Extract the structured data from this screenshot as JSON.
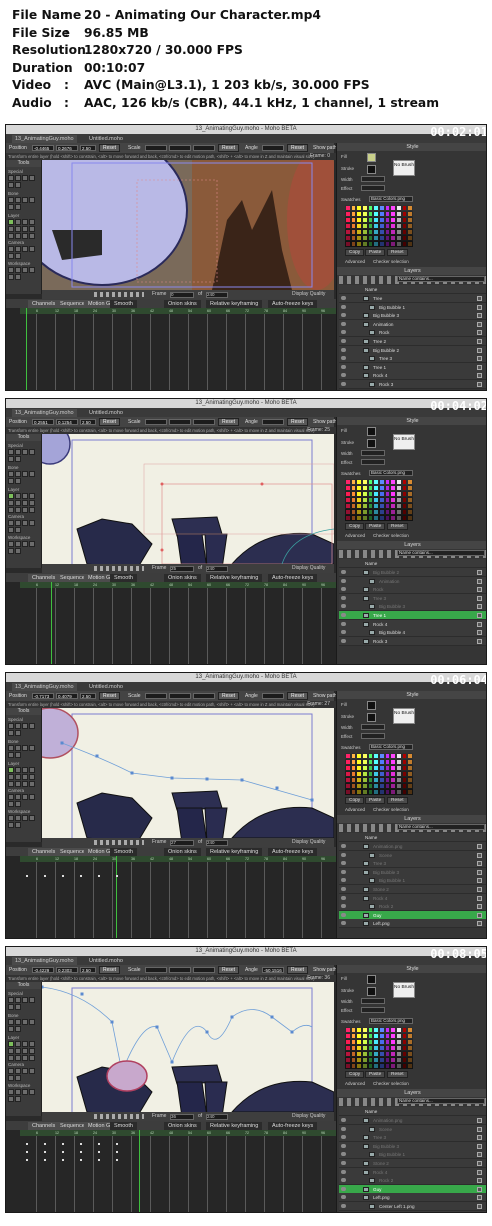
{
  "info": {
    "rows": [
      {
        "label": "File Name",
        "value": "20 - Animating Our Character.mp4"
      },
      {
        "label": "File Size",
        "value": "96.85 MB"
      },
      {
        "label": "Resolution",
        "value": "1280x720 / 30.000 FPS"
      },
      {
        "label": "Duration",
        "value": "00:10:07"
      },
      {
        "label": "Video",
        "value": "AVC (Main@L3.1), 1 203 kb/s, 30.000 FPS"
      },
      {
        "label": "Audio",
        "value": "AAC, 126 kb/s (CBR), 44.1 kHz, 1 channel, 1 stream"
      }
    ],
    "separator": ":"
  },
  "app": {
    "doc_tab_1": "13_AnimatingGuy.moho",
    "doc_tab_2": "Untitled.moho",
    "tools_title": "Tools",
    "tool_groups": [
      "Special",
      "Bone",
      "Layer",
      "Camera",
      "Workspace"
    ],
    "opt_position": "Position",
    "opt_scale": "Scale",
    "opt_angle": "Angle",
    "opt_reset": "Reset",
    "opt_showpath": "Show path",
    "hint": "Transform entire layer (hold <shift> to constrain, <alt> to move forward and back, <ctrl/cmd> to edit motion path, <shift> + <alt> to move in Z and maintain visual size)",
    "style_title": "Style",
    "fill_label": "Fill",
    "stroke_label": "Stroke",
    "width_label": "Width",
    "effect_label": "Effect",
    "no_brush": "No Brush",
    "swatches_label": "Swatches",
    "swatches_value": "Basic Colors.png",
    "copy": "Copy",
    "paste": "Paste",
    "reset": "Reset",
    "advanced": "Advanced",
    "checker": "Checker selection",
    "layers_title": "Layers",
    "name_col": "Name",
    "name_contains": "Name contains...",
    "tl_tabs": [
      "Channels",
      "Sequencer",
      "Motion Graph"
    ],
    "smooth": "Smooth",
    "onion": "Onion skins",
    "relative_kf": "Relative keyframing",
    "auto_freeze": "Auto-freeze keys",
    "display_quality": "Display Quality",
    "frame_label": "Frame",
    "of_label": "of",
    "total_frames": "240",
    "ruler_ticks": [
      "6",
      "12",
      "18",
      "24",
      "30",
      "36",
      "42",
      "48",
      "54",
      "60",
      "66",
      "72",
      "78",
      "84",
      "90",
      "96"
    ]
  },
  "frames": [
    {
      "timecode": "00:02:01",
      "title": "13_AnimatingGuy.moho - Moho BETA",
      "frame_no": "0",
      "status_frame": "Frame: 0",
      "pos_x": "-0.4465",
      "pos_y": "0.2676",
      "pos_z": "2.50",
      "layers": [
        "Tree",
        "Big Bubble 1",
        "Big Bubble 3",
        "Animation",
        "Rock",
        "Tree 2",
        "Big Bubble 2",
        "Tree 3",
        "Tree 1",
        "Rock 4",
        "Rock 3"
      ],
      "selected": -1
    },
    {
      "timecode": "00:04:02",
      "title": "13_AnimatingGuy.moho - Moho BETA",
      "frame_no": "25",
      "status_frame": "Frame: 25",
      "pos_x": "0.2551",
      "pos_y": "0.1254",
      "pos_z": "2.50",
      "layers": [
        "Big Bubble 2",
        "Animation",
        "Rock",
        "Tree 3",
        "Big Bubble 3",
        "Tree 1",
        "Rock 4",
        "Big Bubble 4",
        "Rock 3"
      ],
      "selected": 5
    },
    {
      "timecode": "00:06:04",
      "title": "13_AnimatingGuy.moho - Moho BETA",
      "frame_no": "27",
      "status_frame": "Frame: 27",
      "pos_x": "-0.7173",
      "pos_y": "0.4079",
      "pos_z": "2.50",
      "layers": [
        "Animation.png",
        "Scene",
        "Tree 3",
        "Big Bubble 3",
        "Big Bubble 1",
        "Stone 2",
        "Rock 4",
        "Rock 2",
        "Guy",
        "Left.png"
      ],
      "selected": 8
    },
    {
      "timecode": "00:08:05",
      "title": "13_AnimatingGuy.moho - Moho BETA",
      "frame_no": "36",
      "status_frame": "Frame: 36",
      "pos_x": "-0.4229",
      "pos_y": "0.2303",
      "pos_z": "2.50",
      "angle": "-50.1516",
      "layers": [
        "Animation.png",
        "Scene",
        "Tree 3",
        "Big Bubble 3",
        "Big Bubble 1",
        "Stone 2",
        "Rock 4",
        "Rock 2",
        "Guy",
        "Left.png",
        "Center Left 1.png",
        "Center Left 2.png"
      ],
      "selected": 8
    }
  ]
}
